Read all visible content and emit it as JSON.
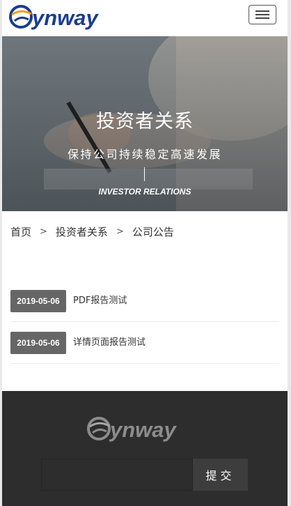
{
  "header": {
    "logo_text": "Synway",
    "menu_button": "menu"
  },
  "banner": {
    "title": "投资者关系",
    "subtitle": "保持公司持续稳定高速发展",
    "english": "INVESTOR RELATIONS"
  },
  "breadcrumb": {
    "items": [
      "首页",
      "投资者关系",
      "公司公告"
    ],
    "separator": ">"
  },
  "news": [
    {
      "date": "2019-05-06",
      "title": "PDF报告测试"
    },
    {
      "date": "2019-05-06",
      "title": "详情页面报告测试"
    }
  ],
  "footer": {
    "logo_text": "Synway",
    "input_placeholder": "",
    "submit_label": "提交"
  },
  "colors": {
    "brand_blue": "#1a3d8f",
    "brand_orange": "#f0a020",
    "date_badge": "#666666",
    "footer_bg": "#2d2d2d"
  }
}
